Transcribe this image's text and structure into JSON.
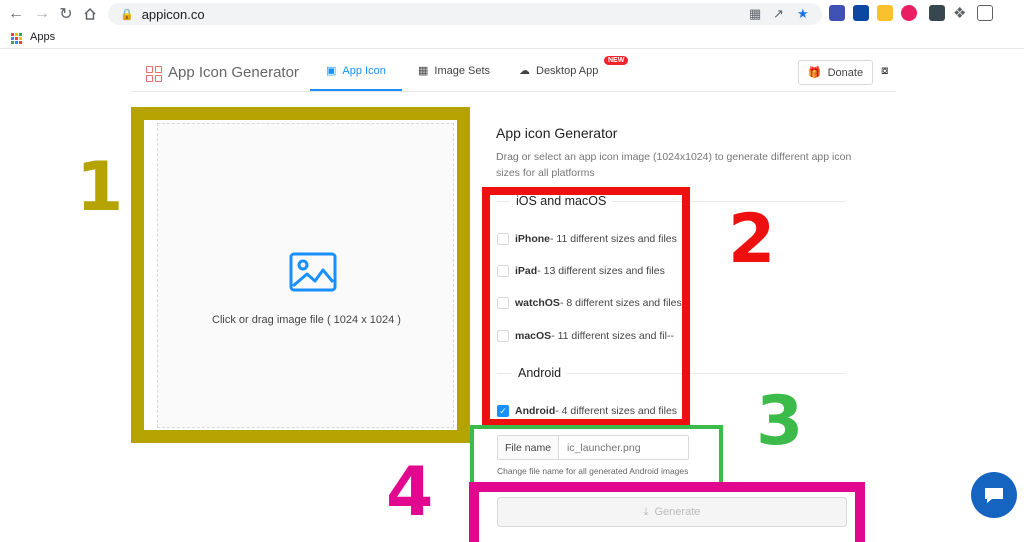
{
  "browser": {
    "url": "appicon.co",
    "bookmarks_apps": "Apps"
  },
  "site": {
    "logo_text": "App Icon Generator",
    "tabs": [
      {
        "label": "App Icon",
        "active": true
      },
      {
        "label": "Image Sets",
        "active": false
      },
      {
        "label": "Desktop App",
        "active": false,
        "badge": "NEW"
      }
    ],
    "donate_label": "Donate"
  },
  "dropzone": {
    "text": "Click or drag image file ( 1024 x 1024 )"
  },
  "form": {
    "title": "App icon Generator",
    "description": "Drag or select an app icon image (1024x1024) to generate different app icon sizes for all platforms",
    "ios_section": "iOS and macOS",
    "ios_options": [
      {
        "name": "iPhone",
        "detail": " - 11 different sizes and files",
        "checked": false
      },
      {
        "name": "iPad",
        "detail": " - 13 different sizes and files",
        "checked": false
      },
      {
        "name": "watchOS",
        "detail": " - 8 different sizes and files",
        "checked": false
      },
      {
        "name": "macOS",
        "detail": " - 11 different sizes and fil--",
        "checked": false
      }
    ],
    "android_section": "Android",
    "android_options": [
      {
        "name": "Android",
        "detail": " - 4 different sizes and files",
        "checked": true
      }
    ],
    "file_name_label": "File name",
    "file_name_placeholder": "ic_launcher.png",
    "file_name_help": "Change file name for all generated Android images",
    "generate_label": "Generate"
  },
  "annotations": {
    "n1": "1",
    "n2": "2",
    "n3": "3",
    "n4": "4",
    "colors": {
      "n1": "#b4a300",
      "n2": "#ee0f0f",
      "n3": "#3cbb4a",
      "n4": "#e1078e"
    }
  },
  "colors": {
    "accent": "#1890ff",
    "badge": "#f5222d",
    "chat": "#1565c0"
  }
}
